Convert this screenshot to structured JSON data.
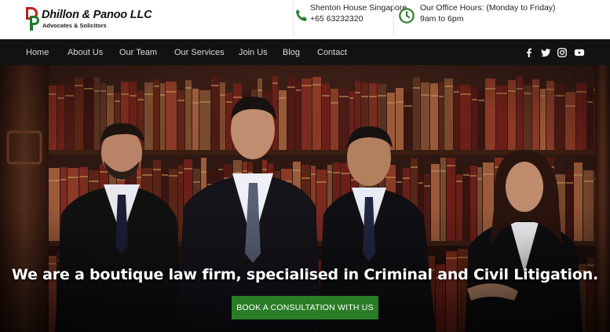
{
  "brand": {
    "name": "Dhillon & Panoo LLC",
    "tagline": "Advocates & Solicitors",
    "mark_letters": "DP",
    "colors": {
      "red": "#c21d1d",
      "green": "#2a7d27"
    }
  },
  "contact": {
    "address": "Shenton House Singapore",
    "phone": "+65 63232320",
    "hours_label": "Our Office Hours: (Monday to Friday)",
    "hours_value": "9am to 6pm",
    "phone_icon": "phone-icon",
    "clock_icon": "clock-icon"
  },
  "nav": {
    "items": [
      "Home",
      "About Us",
      "Our Team",
      "Our Services",
      "Join Us",
      "Blog",
      "Contact"
    ],
    "social": [
      "facebook-icon",
      "twitter-icon",
      "instagram-icon",
      "youtube-icon"
    ]
  },
  "hero": {
    "heading": "We are a boutique law firm, specialised in Criminal and Civil Litigation.",
    "cta_label": "BOOK A CONSULTATION WITH US",
    "cta_color": "#2a7d27"
  }
}
